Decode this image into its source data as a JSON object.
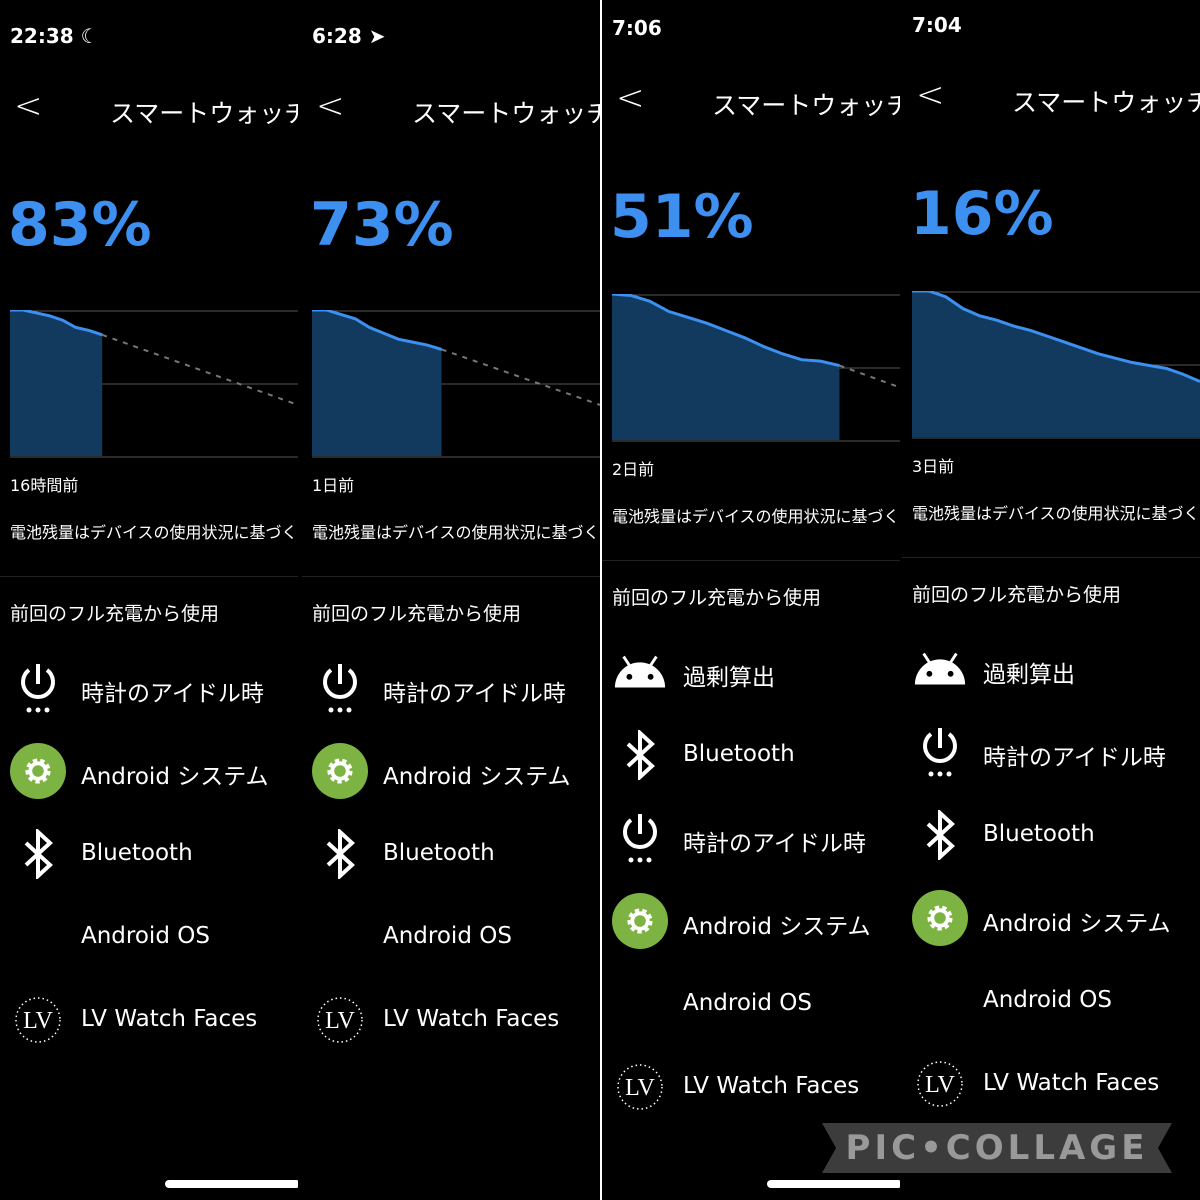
{
  "accent_color": "#3d8ff0",
  "fill_color": "#123a5e",
  "gear_color": "#7cb342",
  "watermark": "PIC•COLLAGE",
  "panels": [
    {
      "time": "22:38",
      "status_icon": "moon-icon",
      "title": "スマートウォッチ",
      "battery_percent": "83%",
      "chart_ago": "16時間前",
      "note": "電池残量はデバイスの使用状況に基づく",
      "section": "前回のフル充電から使用",
      "battery_curve": [
        100,
        100,
        98,
        96,
        93,
        88,
        86,
        83
      ],
      "projection_end": 35,
      "elapsed_fraction": 0.32,
      "apps": [
        {
          "name": "時計のアイドル時",
          "icon": "power-icon"
        },
        {
          "name": "Android システム",
          "icon": "gear-icon"
        },
        {
          "name": "Bluetooth",
          "icon": "bluetooth-icon"
        },
        {
          "name": "Android OS",
          "icon": ""
        },
        {
          "name": "LV Watch Faces",
          "icon": "lv-logo-icon"
        }
      ]
    },
    {
      "time": "6:28",
      "status_icon": "location-arrow-icon",
      "title": "スマートウォッチ",
      "battery_percent": "73%",
      "chart_ago": "1日前",
      "note": "電池残量はデバイスの使用状況に基づく",
      "section": "前回のフル充電から使用",
      "battery_curve": [
        100,
        100,
        97,
        94,
        88,
        84,
        80,
        78,
        76,
        73
      ],
      "projection_end": 35,
      "elapsed_fraction": 0.45,
      "apps": [
        {
          "name": "時計のアイドル時",
          "icon": "power-icon"
        },
        {
          "name": "Android システム",
          "icon": "gear-icon"
        },
        {
          "name": "Bluetooth",
          "icon": "bluetooth-icon"
        },
        {
          "name": "Android OS",
          "icon": ""
        },
        {
          "name": "LV Watch Faces",
          "icon": "lv-logo-icon"
        }
      ]
    },
    {
      "time": "7:06",
      "status_icon": "",
      "title": "スマートウォッチ",
      "battery_percent": "51%",
      "chart_ago": "2日前",
      "note": "電池残量はデバイスの使用状況に基づく",
      "section": "前回のフル充電から使用",
      "battery_curve": [
        100,
        99,
        95,
        88,
        84,
        80,
        75,
        70,
        64,
        59,
        55,
        54,
        51
      ],
      "projection_end": 36,
      "elapsed_fraction": 0.79,
      "apps": [
        {
          "name": "過剰算出",
          "icon": "android-icon"
        },
        {
          "name": "Bluetooth",
          "icon": "bluetooth-icon"
        },
        {
          "name": "時計のアイドル時",
          "icon": "power-icon"
        },
        {
          "name": "Android システム",
          "icon": "gear-icon"
        },
        {
          "name": "Android OS",
          "icon": ""
        },
        {
          "name": "LV Watch Faces",
          "icon": "lv-logo-icon"
        }
      ]
    },
    {
      "time": "7:04",
      "status_icon": "",
      "title": "スマートウォッチ",
      "battery_percent": "16%",
      "chart_ago": "3日前",
      "note": "電池残量はデバイスの使用状況に基づく",
      "section": "前回のフル充電から使用",
      "battery_curve": [
        100,
        100,
        96,
        88,
        83,
        80,
        76,
        73,
        69,
        65,
        61,
        57,
        54,
        51,
        49,
        47,
        43,
        38
      ],
      "projection_end": null,
      "elapsed_fraction": 1.0,
      "apps": [
        {
          "name": "過剰算出",
          "icon": "android-icon"
        },
        {
          "name": "時計のアイドル時",
          "icon": "power-icon"
        },
        {
          "name": "Bluetooth",
          "icon": "bluetooth-icon"
        },
        {
          "name": "Android システム",
          "icon": "gear-icon"
        },
        {
          "name": "Android OS",
          "icon": ""
        },
        {
          "name": "LV Watch Faces",
          "icon": "lv-logo-icon"
        }
      ]
    }
  ]
}
